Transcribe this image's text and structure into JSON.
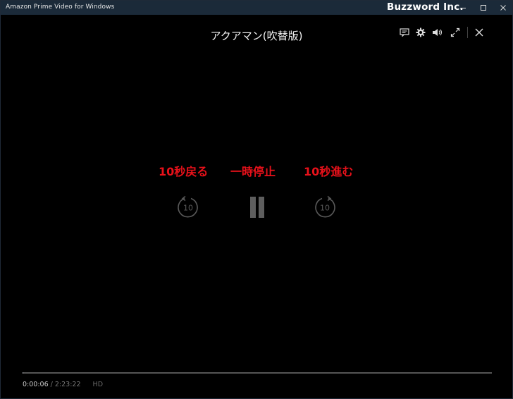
{
  "window": {
    "app_title": "Amazon Prime Video for Windows",
    "watermark": "Buzzword Inc."
  },
  "player": {
    "title": "アクアマン(吹替版)",
    "top_icons": [
      "subtitles-icon",
      "gear-icon",
      "volume-icon",
      "fullscreen-icon",
      "close-icon"
    ],
    "annotations": {
      "rewind": "10秒戻る",
      "pause": "一時停止",
      "forward": "10秒進む"
    },
    "rewind_seconds": "10",
    "forward_seconds": "10",
    "annotation_color": "#e8111a",
    "progress": {
      "current": "0:00:06",
      "separator": "/",
      "total": "2:23:22",
      "quality": "HD",
      "fraction": 0.0007
    }
  }
}
